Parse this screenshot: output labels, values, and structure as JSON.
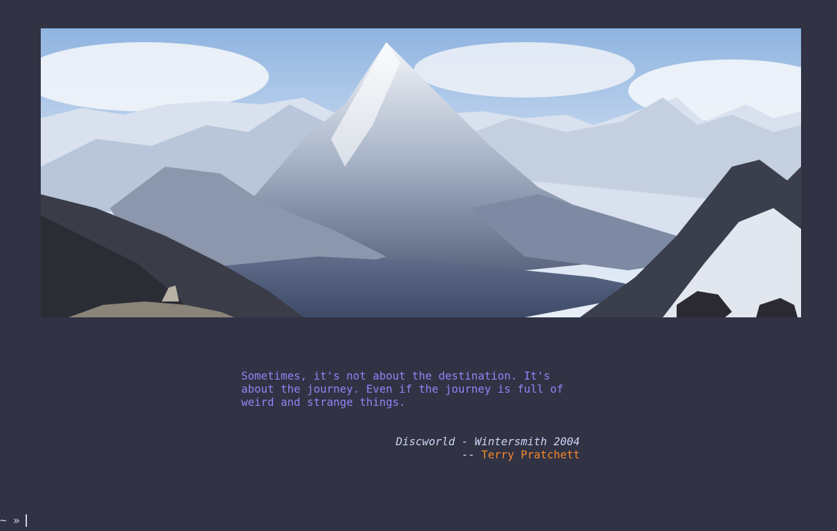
{
  "banner": {
    "image_name": "mountain-landscape-image"
  },
  "quote": {
    "lines": [
      "Sometimes, it's not about the destination. It's",
      "about the journey. Even if the journey is full of",
      "weird and strange things."
    ]
  },
  "source": {
    "work": "Discworld - Wintersmith 2004",
    "author_prefix": "-- ",
    "author": "Terry Pratchett"
  },
  "prompt": {
    "text": "~ »"
  },
  "colors": {
    "background": "#313244",
    "quote": "#8f86f5",
    "author": "#f5892d",
    "text": "#cdd6f4"
  }
}
